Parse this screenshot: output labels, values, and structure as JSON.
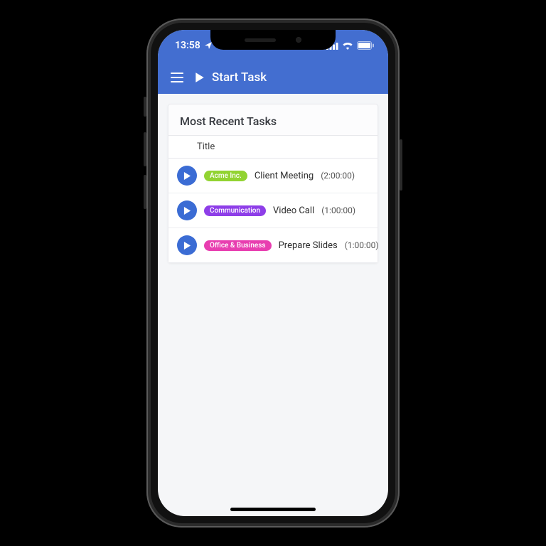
{
  "status": {
    "time": "13:58"
  },
  "header": {
    "title": "Start Task"
  },
  "card": {
    "title": "Most Recent Tasks",
    "column": "Title"
  },
  "tasks": [
    {
      "tag": "Acme Inc.",
      "tag_color": "#92d332",
      "title": "Client Meeting",
      "duration": "(2:00:00)"
    },
    {
      "tag": "Communication",
      "tag_color": "#8e3ee8",
      "title": "Video Call",
      "duration": "(1:00:00)"
    },
    {
      "tag": "Office & Business",
      "tag_color": "#e83eb0",
      "title": "Prepare Slides",
      "duration": "(1:00:00)"
    }
  ],
  "colors": {
    "brand": "#436ed0",
    "play": "#3b6cd4"
  }
}
